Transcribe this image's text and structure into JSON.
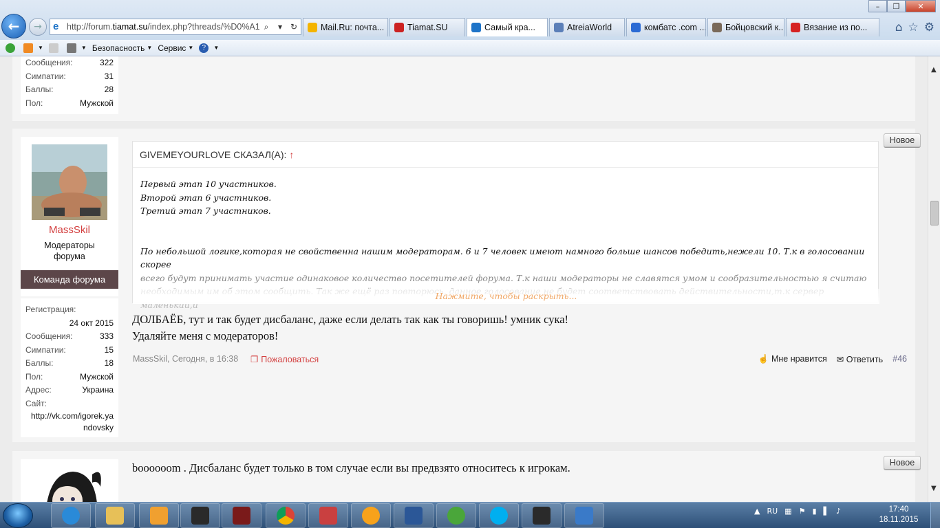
{
  "browser": {
    "address_prefix": "http://forum.",
    "address_domain": "tiamat.su",
    "address_suffix": "/index.php?threads/%D0%A1%",
    "tabs": [
      {
        "label": "Mail.Ru: почта...",
        "icon_color": "#f4b400"
      },
      {
        "label": "Tiamat.SU",
        "icon_color": "#cc2222"
      },
      {
        "label": "Самый кра...",
        "icon_color": "#1e74c8"
      },
      {
        "label": "AtreiaWorld",
        "icon_color": "#5b7fb8"
      },
      {
        "label": "комбатс .com ...",
        "icon_color": "#2a6ad4"
      },
      {
        "label": "Бойцовский к...",
        "icon_color": "#7a6a5a"
      },
      {
        "label": "Вязание из по...",
        "icon_color": "#d62222"
      }
    ],
    "active_tab_index": 2,
    "command_bar": {
      "safety": "Безопасность",
      "service": "Сервис",
      "help": "?"
    }
  },
  "posts": {
    "prev_stats": [
      {
        "k": "Сообщения:",
        "v": "322"
      },
      {
        "k": "Симпатии:",
        "v": "31"
      },
      {
        "k": "Баллы:",
        "v": "28"
      },
      {
        "k": "Пол:",
        "v": "Мужской"
      }
    ],
    "main": {
      "username": "MassSkil",
      "user_title": "Модераторы форума",
      "team_label": "Команда форума",
      "badge_new": "Новое",
      "stats": [
        {
          "k": "Регистрация:",
          "v": ""
        },
        {
          "k": "",
          "v": "24 окт 2015"
        },
        {
          "k": "Сообщения:",
          "v": "333"
        },
        {
          "k": "Симпатии:",
          "v": "15"
        },
        {
          "k": "Баллы:",
          "v": "18"
        },
        {
          "k": "Пол:",
          "v": "Мужской"
        },
        {
          "k": "Адрес:",
          "v": "Украина"
        },
        {
          "k": "Сайт:",
          "v": ""
        }
      ],
      "site_line1": "http://vk.com/igorek.ya",
      "site_line2": "ndovsky",
      "quote_author": "GIVEMEYOURLOVE СКАЗАЛ(А):",
      "quote_arrow": "↑",
      "quote_lines": [
        "Первый этап 10 участников.",
        "Второй этап 6 участников.",
        "Третий этап 7 участников."
      ],
      "quote_para1": "По небольшой логике,которая не свойственна нашим модераторам. 6 и 7 человек имеют намного больше шансов победить,нежели 10. Т.к в голосовании скорее",
      "quote_para2": "всего будут принимать участие одинаковое количество посетителей форума. Т.к наши модераторы не славятся умом и сообразительностью я считаю",
      "quote_para3": "необходимым им об этом сообщить. Так же ещё раз повторюсь, данное голосование не будет соответствовать действительности,т.к сервер маленький,и",
      "expand_label": "Нажмите, чтобы раскрыть...",
      "message_line1": "ДОЛБАЁБ, тут и так будет дисбаланс, даже если делать так как ты говоришь! умник сука!",
      "message_line2": "Удаляйте меня с модераторов!",
      "meta": "MassSkil, Сегодня, в 16:38",
      "report": "Пожаловаться",
      "like": "Мне нравится",
      "reply": "Ответить",
      "post_number": "#46"
    },
    "next": {
      "badge_new": "Новое",
      "message": "boooooom . Дисбаланс будет только в том случае если вы предвзято относитесь к игрокам."
    }
  },
  "taskbar": {
    "lang": "RU",
    "time": "17:40",
    "date": "18.11.2015"
  }
}
